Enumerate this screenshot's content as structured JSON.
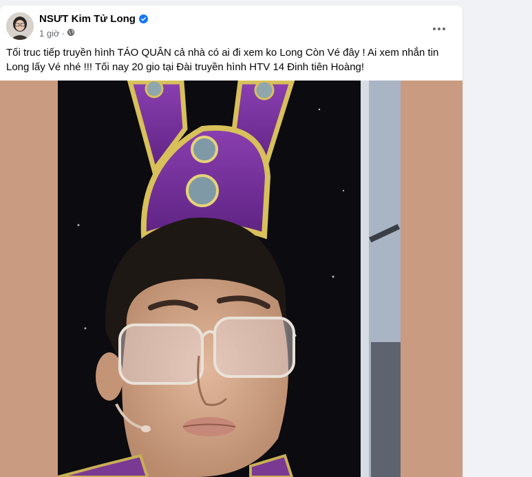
{
  "post": {
    "author": "NSƯT Kim Tử Long",
    "time": "1 giờ",
    "caption": "Tối truc tiếp truyền hình TÁO QUÂN cả nhà có ai đi xem ko Long Còn Vé đây ! Ai xem nhắn tin Long lấy Vé nhé !!! Tối nay 20 gio tại Đài truyền hình HTV 14 Đinh tiên Hoàng!",
    "more_icon": "more-horizontal-icon",
    "privacy_icon": "public-globe-icon",
    "verified_icon": "verified-badge-icon"
  },
  "colors": {
    "accent": "#1877f2",
    "media_background": "#c99b80",
    "page_background": "#f0f2f5"
  }
}
